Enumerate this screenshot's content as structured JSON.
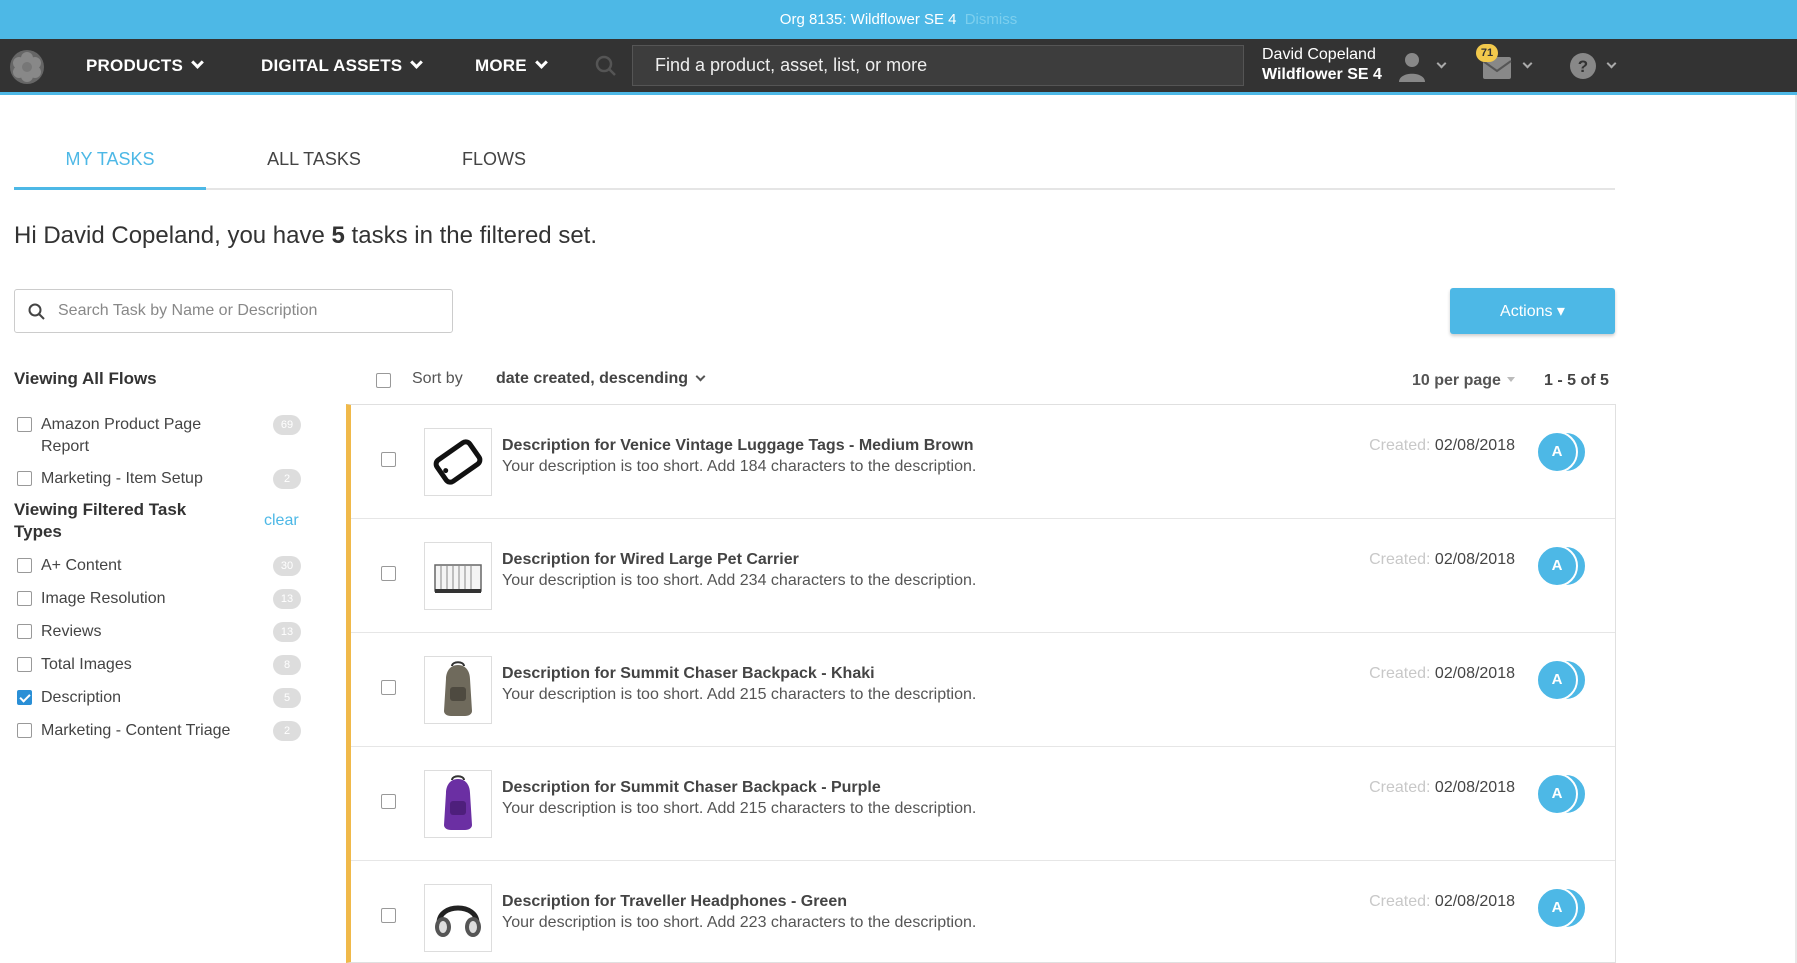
{
  "banner": {
    "org_text": "Org 8135: Wildflower SE 4",
    "dismiss": "Dismiss"
  },
  "nav": {
    "products": "PRODUCTS",
    "digital_assets": "DIGITAL ASSETS",
    "more": "MORE",
    "search_placeholder": "Find a product, asset, list, or more",
    "user_name": "David Copeland",
    "user_org": "Wildflower SE 4",
    "notification_count": "71"
  },
  "tabs": [
    {
      "label": "MY TASKS",
      "active": true
    },
    {
      "label": "ALL TASKS",
      "active": false
    },
    {
      "label": "FLOWS",
      "active": false
    }
  ],
  "greeting": {
    "prefix": "Hi David Copeland, you have ",
    "count": "5",
    "suffix": " tasks in the filtered set."
  },
  "task_search": {
    "placeholder": "Search Task by Name or Description"
  },
  "actions_label": "Actions ▾",
  "filters": {
    "flows_heading": "Viewing All Flows",
    "flows": [
      {
        "label": "Amazon Product Page Report",
        "count": "69",
        "checked": false
      },
      {
        "label": "Marketing - Item Setup",
        "count": "2",
        "checked": false
      }
    ],
    "types_heading": "Viewing Filtered Task Types",
    "clear": "clear",
    "types": [
      {
        "label": "A+ Content",
        "count": "30",
        "checked": false
      },
      {
        "label": "Image Resolution",
        "count": "13",
        "checked": false
      },
      {
        "label": "Reviews",
        "count": "13",
        "checked": false
      },
      {
        "label": "Total Images",
        "count": "8",
        "checked": false
      },
      {
        "label": "Description",
        "count": "5",
        "checked": true
      },
      {
        "label": "Marketing - Content Triage",
        "count": "2",
        "checked": false
      }
    ]
  },
  "sort": {
    "label": "Sort by",
    "value": "date created, descending",
    "per_page": "10 per page",
    "range": "1 - 5 of 5"
  },
  "tasks": [
    {
      "title": "Description for Venice Vintage Luggage Tags - Medium Brown",
      "desc": "Your description is too short. Add 184 characters to the description.",
      "created_label": "Created:",
      "created": "02/08/2018",
      "avatar": "A",
      "thumb": "luggage-tag"
    },
    {
      "title": "Description for Wired Large Pet Carrier",
      "desc": "Your description is too short. Add 234 characters to the description.",
      "created_label": "Created:",
      "created": "02/08/2018",
      "avatar": "A",
      "thumb": "pet-carrier"
    },
    {
      "title": "Description for Summit Chaser Backpack - Khaki",
      "desc": "Your description is too short. Add 215 characters to the description.",
      "created_label": "Created:",
      "created": "02/08/2018",
      "avatar": "A",
      "thumb": "backpack-khaki"
    },
    {
      "title": "Description for Summit Chaser Backpack - Purple",
      "desc": "Your description is too short. Add 215 characters to the description.",
      "created_label": "Created:",
      "created": "02/08/2018",
      "avatar": "A",
      "thumb": "backpack-purple"
    },
    {
      "title": "Description for Traveller Headphones - Green",
      "desc": "Your description is too short. Add 223 characters to the description.",
      "created_label": "Created:",
      "created": "02/08/2018",
      "avatar": "A",
      "thumb": "headphones"
    }
  ],
  "colors": {
    "accent": "#4db8e6",
    "nav_bg": "#333333",
    "row_marker": "#f0b94a",
    "checkbox_checked": "#2a8fd6"
  }
}
